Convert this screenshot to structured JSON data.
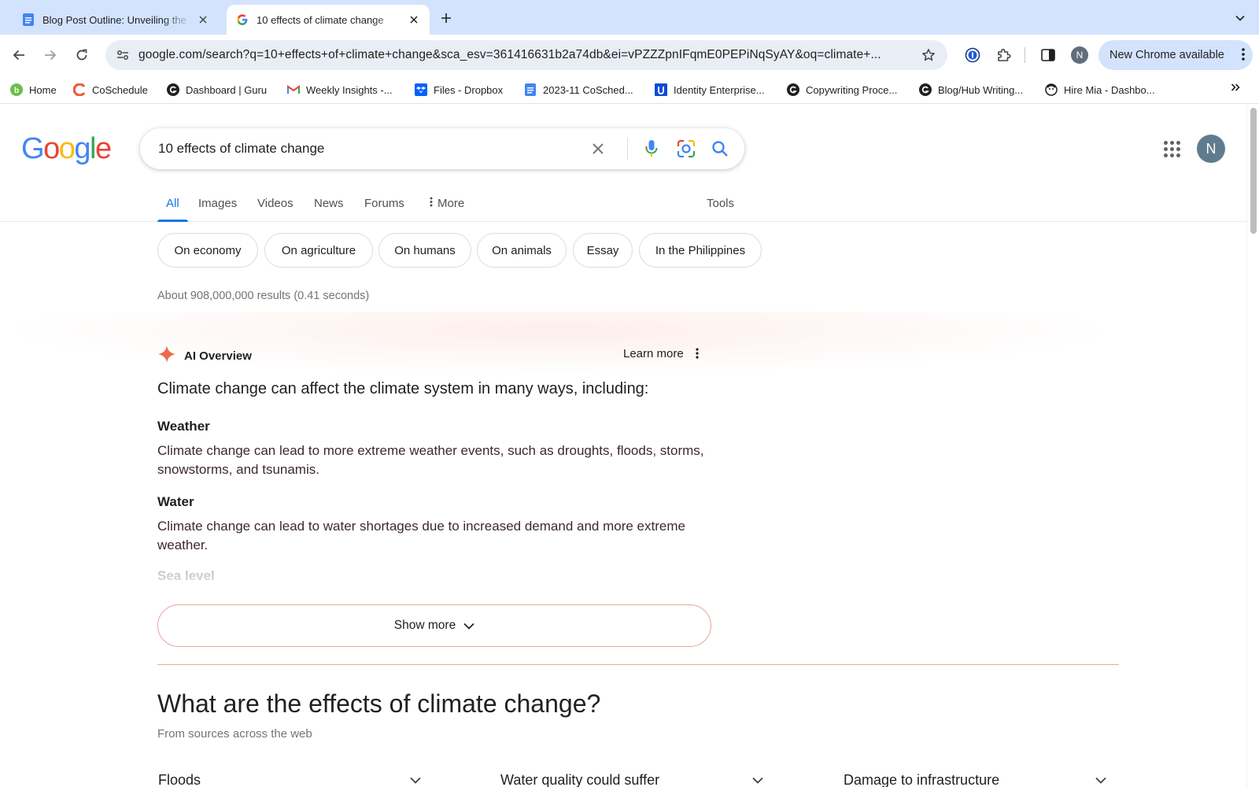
{
  "browser": {
    "tabs": [
      {
        "title": "Blog Post Outline: Unveiling the",
        "favicon": "docs-icon",
        "active": false
      },
      {
        "title": "10 effects of climate change",
        "favicon": "google-g-icon",
        "active": true
      }
    ],
    "url": "google.com/search?q=10+effects+of+climate+change&sca_esv=361416631b2a74db&ei=vPZZZpnIFqmE0PEPiNqSyAY&oq=climate+...",
    "profile_initial": "N",
    "update_button": "New Chrome available",
    "bookmarks": [
      {
        "label": "Home",
        "icon": "home-icon"
      },
      {
        "label": "CoSchedule",
        "icon": "coschedule-icon"
      },
      {
        "label": "Dashboard | Guru",
        "icon": "guru-icon"
      },
      {
        "label": "Weekly Insights -...",
        "icon": "gmail-icon"
      },
      {
        "label": "Files - Dropbox",
        "icon": "dropbox-icon"
      },
      {
        "label": "2023-11 CoSched...",
        "icon": "docs-icon"
      },
      {
        "label": "Identity Enterprise...",
        "icon": "identity-icon"
      },
      {
        "label": "Copywriting Proce...",
        "icon": "guru-icon"
      },
      {
        "label": "Blog/Hub Writing...",
        "icon": "guru-icon"
      },
      {
        "label": "Hire Mia - Dashbo...",
        "icon": "mia-icon"
      }
    ]
  },
  "google": {
    "logo": [
      "G",
      "o",
      "o",
      "g",
      "l",
      "e"
    ],
    "logo_colors": [
      "#4285f4",
      "#ea4335",
      "#fbbc05",
      "#4285f4",
      "#34a853",
      "#ea4335"
    ],
    "query": "10 effects of climate change",
    "profile_initial": "N",
    "tabs": [
      "All",
      "Images",
      "Videos",
      "News",
      "Forums",
      "More",
      "Tools"
    ],
    "chips": [
      "On economy",
      "On agriculture",
      "On humans",
      "On animals",
      "Essay",
      "In the Philippines"
    ],
    "stats": "About 908,000,000 results (0.41 seconds)"
  },
  "ai_overview": {
    "label": "AI Overview",
    "learn_more": "Learn more",
    "intro": "Climate change can affect the climate system in many ways, including:",
    "sections": [
      {
        "heading": "Weather",
        "text": "Climate change can lead to more extreme weather events, such as droughts, floods, storms, snowstorms, and tsunamis."
      },
      {
        "heading": "Water",
        "text": "Climate change can lead to water shortages due to increased demand and more extreme weather."
      },
      {
        "heading": "Sea level",
        "text": ""
      }
    ],
    "show_more": "Show more"
  },
  "effects": {
    "title": "What are the effects of climate change?",
    "subtitle": "From sources across the web",
    "items": [
      "Floods",
      "Water quality could suffer",
      "Damage to infrastructure"
    ]
  },
  "colors": {
    "tabstrip": "#d3e3fd",
    "google_blue": "#1a73e8",
    "ai_accent": "#f2a79d"
  }
}
